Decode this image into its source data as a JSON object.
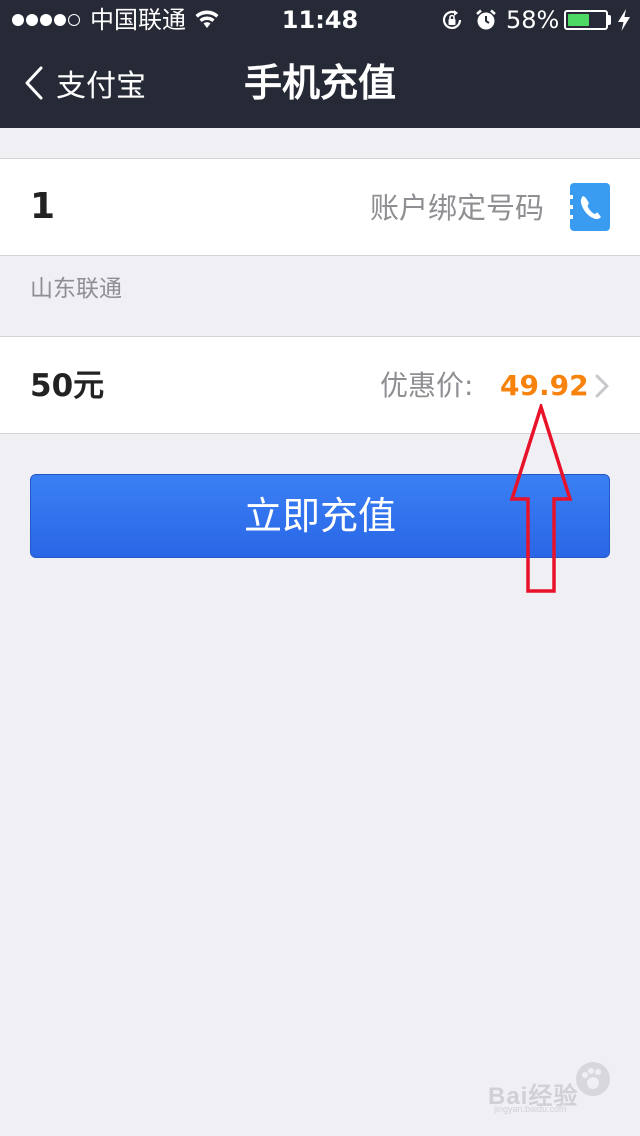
{
  "status_bar": {
    "carrier": "中国联通",
    "time": "11:48",
    "battery_percent_text": "58%",
    "battery_level": 0.58,
    "battery_color": "#4cd964",
    "icons": [
      "signal-dots",
      "wifi-icon",
      "rotation-lock-icon",
      "alarm-icon",
      "battery-icon",
      "charging-icon"
    ]
  },
  "nav": {
    "back_label": "支付宝",
    "back_icon": "chevron-left-icon",
    "title": "手机充值",
    "background_color": "#262a36"
  },
  "phone_row": {
    "number": "1",
    "bind_label": "账户绑定号码",
    "contacts_icon": "phone-contacts-icon",
    "icon_color": "#3a9cf0"
  },
  "carrier_info": "山东联通",
  "amount_row": {
    "amount": "50元",
    "discount_label": "优惠价:",
    "discount_price": "49.92",
    "price_color": "#f7830c",
    "chevron_icon": "chevron-right-icon"
  },
  "recharge_button": {
    "label": "立即充值",
    "color": "#2f72ee"
  },
  "annotation": {
    "icon": "red-up-arrow",
    "color": "#e8132a"
  },
  "watermark": {
    "text": "Bai经验",
    "subtext": "jingyan.baidu.com"
  }
}
